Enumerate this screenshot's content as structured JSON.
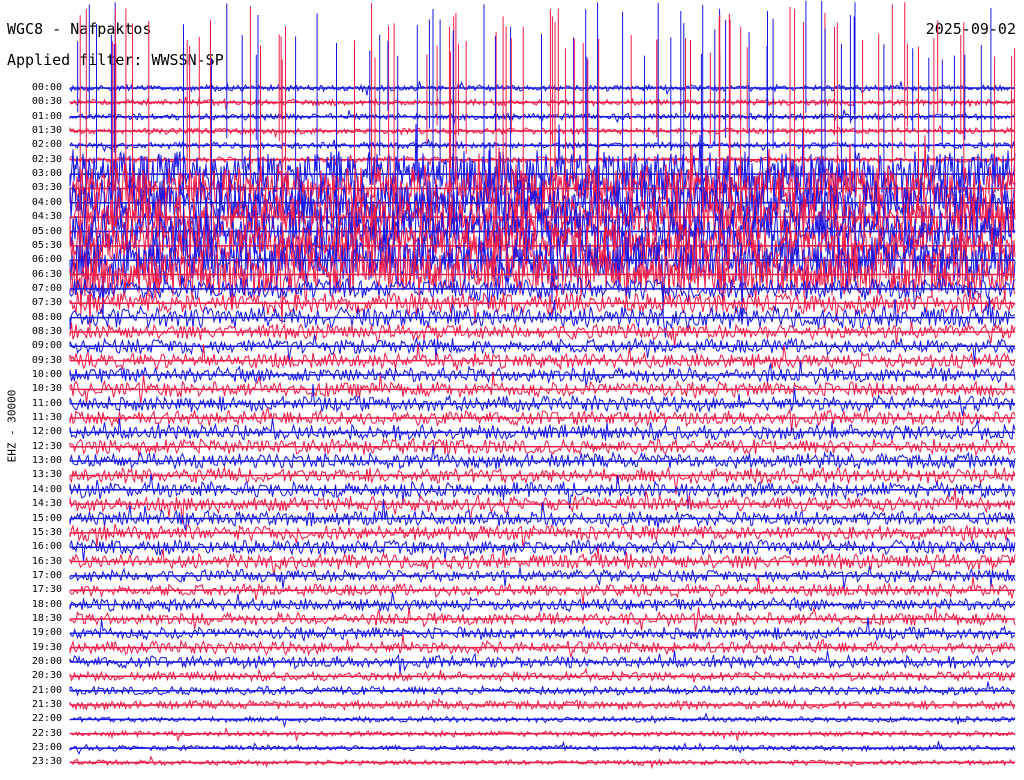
{
  "header": {
    "station": "WGC8 - Nafpaktos",
    "date": "2025-09-02",
    "filter": "Applied filter: WWSSN-SP"
  },
  "channel_label": "EHZ - 30000",
  "colors": {
    "trace_a": "#1515e6",
    "trace_b": "#f01a47",
    "text": "#000000",
    "background": "#ffffff"
  },
  "rows": [
    "00:00",
    "00:30",
    "01:00",
    "01:30",
    "02:00",
    "02:30",
    "03:00",
    "03:30",
    "04:00",
    "04:30",
    "05:00",
    "05:30",
    "06:00",
    "06:30",
    "07:00",
    "07:30",
    "08:00",
    "08:30",
    "09:00",
    "09:30",
    "10:00",
    "10:30",
    "11:00",
    "11:30",
    "12:00",
    "12:30",
    "13:00",
    "13:30",
    "14:00",
    "14:30",
    "15:00",
    "15:30",
    "16:00",
    "16:30",
    "17:00",
    "17:30",
    "18:00",
    "18:30",
    "19:00",
    "19:30",
    "20:00",
    "20:30",
    "21:00",
    "21:30",
    "22:00",
    "22:30",
    "23:00",
    "23:30"
  ]
}
